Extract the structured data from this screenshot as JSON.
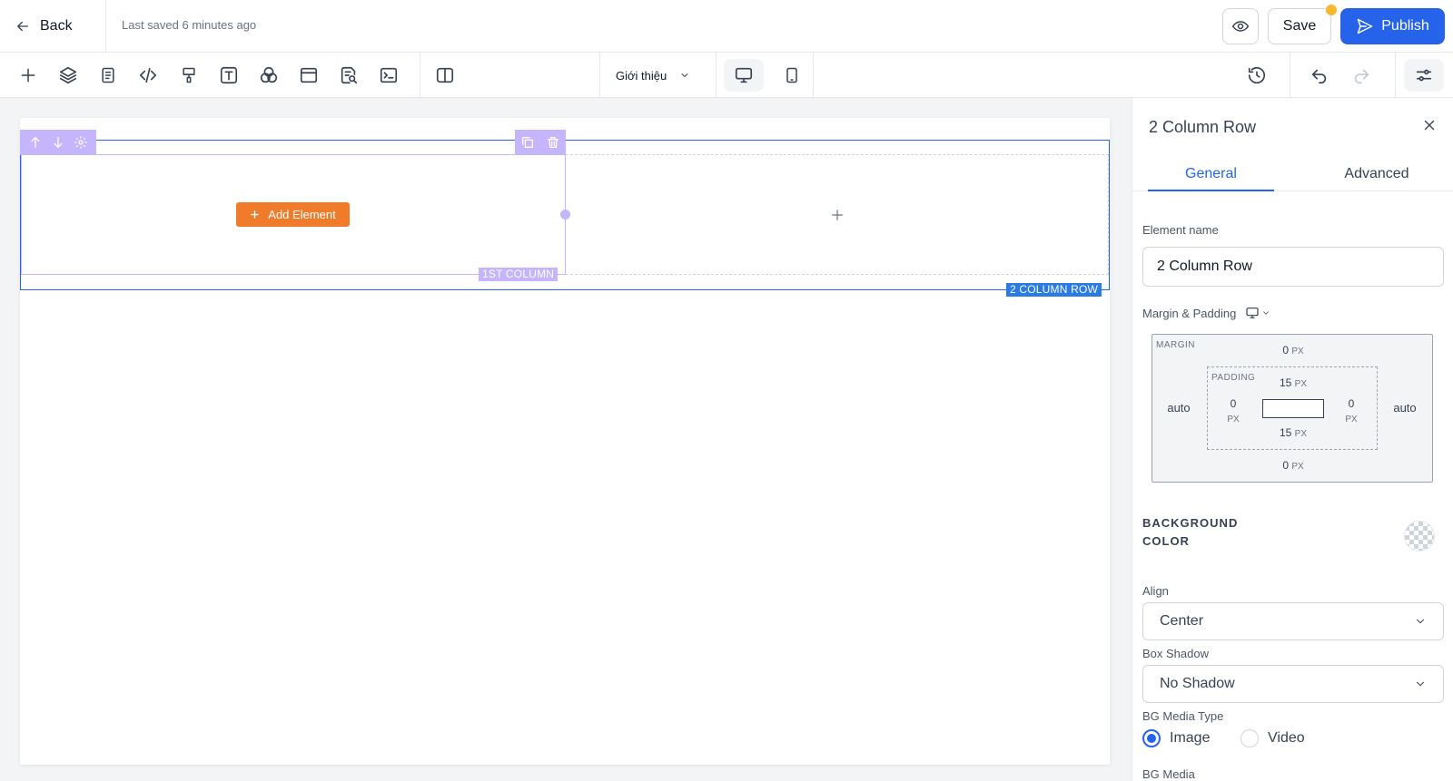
{
  "header": {
    "back_label": "Back",
    "saved_text": "Last saved 6 minutes ago",
    "save_label": "Save",
    "publish_label": "Publish",
    "accent_color": "#2563eb",
    "notification_dot_color": "#f5b82e"
  },
  "toolbar": {
    "tools": [
      "plus-icon",
      "layers-icon",
      "page-icon",
      "code-icon",
      "paint-icon",
      "text-icon",
      "components-icon",
      "layout-icon",
      "search-doc-icon",
      "terminal-icon",
      "columns-icon"
    ],
    "page_selector": "Giới thiệu",
    "devices": [
      "desktop-icon",
      "mobile-icon"
    ],
    "right_tools": [
      "history-icon",
      "undo-icon",
      "redo-icon",
      "settings-sliders-icon"
    ]
  },
  "canvas": {
    "add_element_label": "Add Element",
    "column_label": "1ST COLUMN",
    "row_label": "2 COLUMN ROW",
    "button_color": "#f07c2b",
    "column_color": "#c4b5fd",
    "row_color": "#2b7be5"
  },
  "panel": {
    "title": "2 Column Row",
    "tabs": [
      {
        "label": "General",
        "active": true
      },
      {
        "label": "Advanced",
        "active": false
      }
    ],
    "element_name_label": "Element name",
    "element_name_value": "2 Column Row",
    "margin_padding_label": "Margin & Padding",
    "margin": {
      "label": "MARGIN",
      "top": "0",
      "bottom": "0",
      "left": "auto",
      "right": "auto"
    },
    "padding": {
      "label": "PADDING",
      "top": "15",
      "bottom": "15",
      "left": "0",
      "right": "0"
    },
    "unit": "PX",
    "background_color_label": "BACKGROUND COLOR",
    "align_label": "Align",
    "align_value": "Center",
    "box_shadow_label": "Box Shadow",
    "box_shadow_value": "No Shadow",
    "bg_media_type_label": "BG Media Type",
    "bg_media_options": [
      {
        "label": "Image",
        "selected": true
      },
      {
        "label": "Video",
        "selected": false
      }
    ],
    "bg_media_label": "BG Media"
  }
}
